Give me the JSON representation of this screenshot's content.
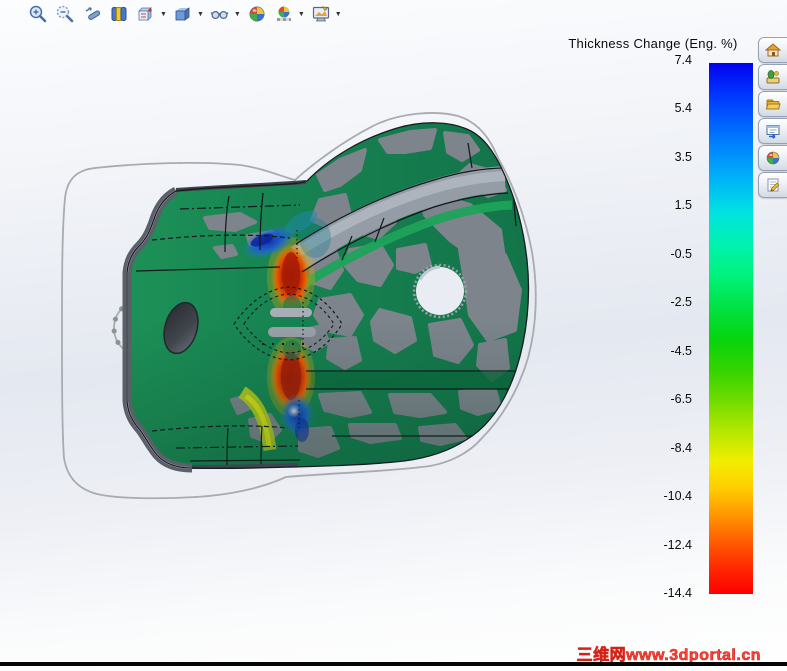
{
  "legend": {
    "title": "Thickness Change (Eng. %)",
    "ticks": [
      "7.4",
      "5.4",
      "3.5",
      "1.5",
      "-0.5",
      "-2.5",
      "-4.5",
      "-6.5",
      "-8.4",
      "-10.4",
      "-12.4",
      "-14.4"
    ],
    "colorbar_stops": [
      {
        "pos": 0.0,
        "color": "#0202ee"
      },
      {
        "pos": 0.06,
        "color": "#0036ff"
      },
      {
        "pos": 0.14,
        "color": "#0077ff"
      },
      {
        "pos": 0.22,
        "color": "#00b4f8"
      },
      {
        "pos": 0.28,
        "color": "#00e2e2"
      },
      {
        "pos": 0.34,
        "color": "#00f2b0"
      },
      {
        "pos": 0.4,
        "color": "#00f27c"
      },
      {
        "pos": 0.46,
        "color": "#00e243"
      },
      {
        "pos": 0.52,
        "color": "#06d40e"
      },
      {
        "pos": 0.58,
        "color": "#35d400"
      },
      {
        "pos": 0.64,
        "color": "#76dc00"
      },
      {
        "pos": 0.7,
        "color": "#bce800"
      },
      {
        "pos": 0.75,
        "color": "#f2ee00"
      },
      {
        "pos": 0.8,
        "color": "#ffce00"
      },
      {
        "pos": 0.85,
        "color": "#ff9800"
      },
      {
        "pos": 0.9,
        "color": "#ff5e00"
      },
      {
        "pos": 0.95,
        "color": "#ff2a00"
      },
      {
        "pos": 1.0,
        "color": "#fe0000"
      }
    ]
  },
  "toolbar": {
    "buttons": [
      {
        "icon": "zoom-in-magnifier",
        "has_dropdown": false
      },
      {
        "icon": "zoom-area-magnifier",
        "has_dropdown": false
      },
      {
        "icon": "zoom-wand",
        "has_dropdown": false
      },
      {
        "icon": "section-view",
        "has_dropdown": false
      },
      {
        "icon": "view-orientation-cube",
        "has_dropdown": true
      },
      {
        "icon": "display-style-cube",
        "has_dropdown": true
      },
      {
        "icon": "hide-show-glasses",
        "has_dropdown": true
      },
      {
        "icon": "appearance-ball",
        "has_dropdown": false
      },
      {
        "icon": "apply-scene-ball",
        "has_dropdown": true
      },
      {
        "icon": "view-settings-monitor",
        "has_dropdown": true
      }
    ]
  },
  "task_pane": {
    "buttons": [
      {
        "icon": "home"
      },
      {
        "icon": "design-library"
      },
      {
        "icon": "file-explorer-folder"
      },
      {
        "icon": "view-palette"
      },
      {
        "icon": "appearances-ball"
      },
      {
        "icon": "custom-properties-sheet"
      }
    ]
  },
  "watermark": {
    "text": "三维网www.3dportal.cn",
    "color": "#fa4638"
  },
  "model": {
    "result_type": "thickness-change-plot",
    "base_color": "#168151",
    "undeformed_gray": "#7d848c",
    "hotspot_red": "#c22708",
    "hotspot_blue": "#1e63c8"
  }
}
